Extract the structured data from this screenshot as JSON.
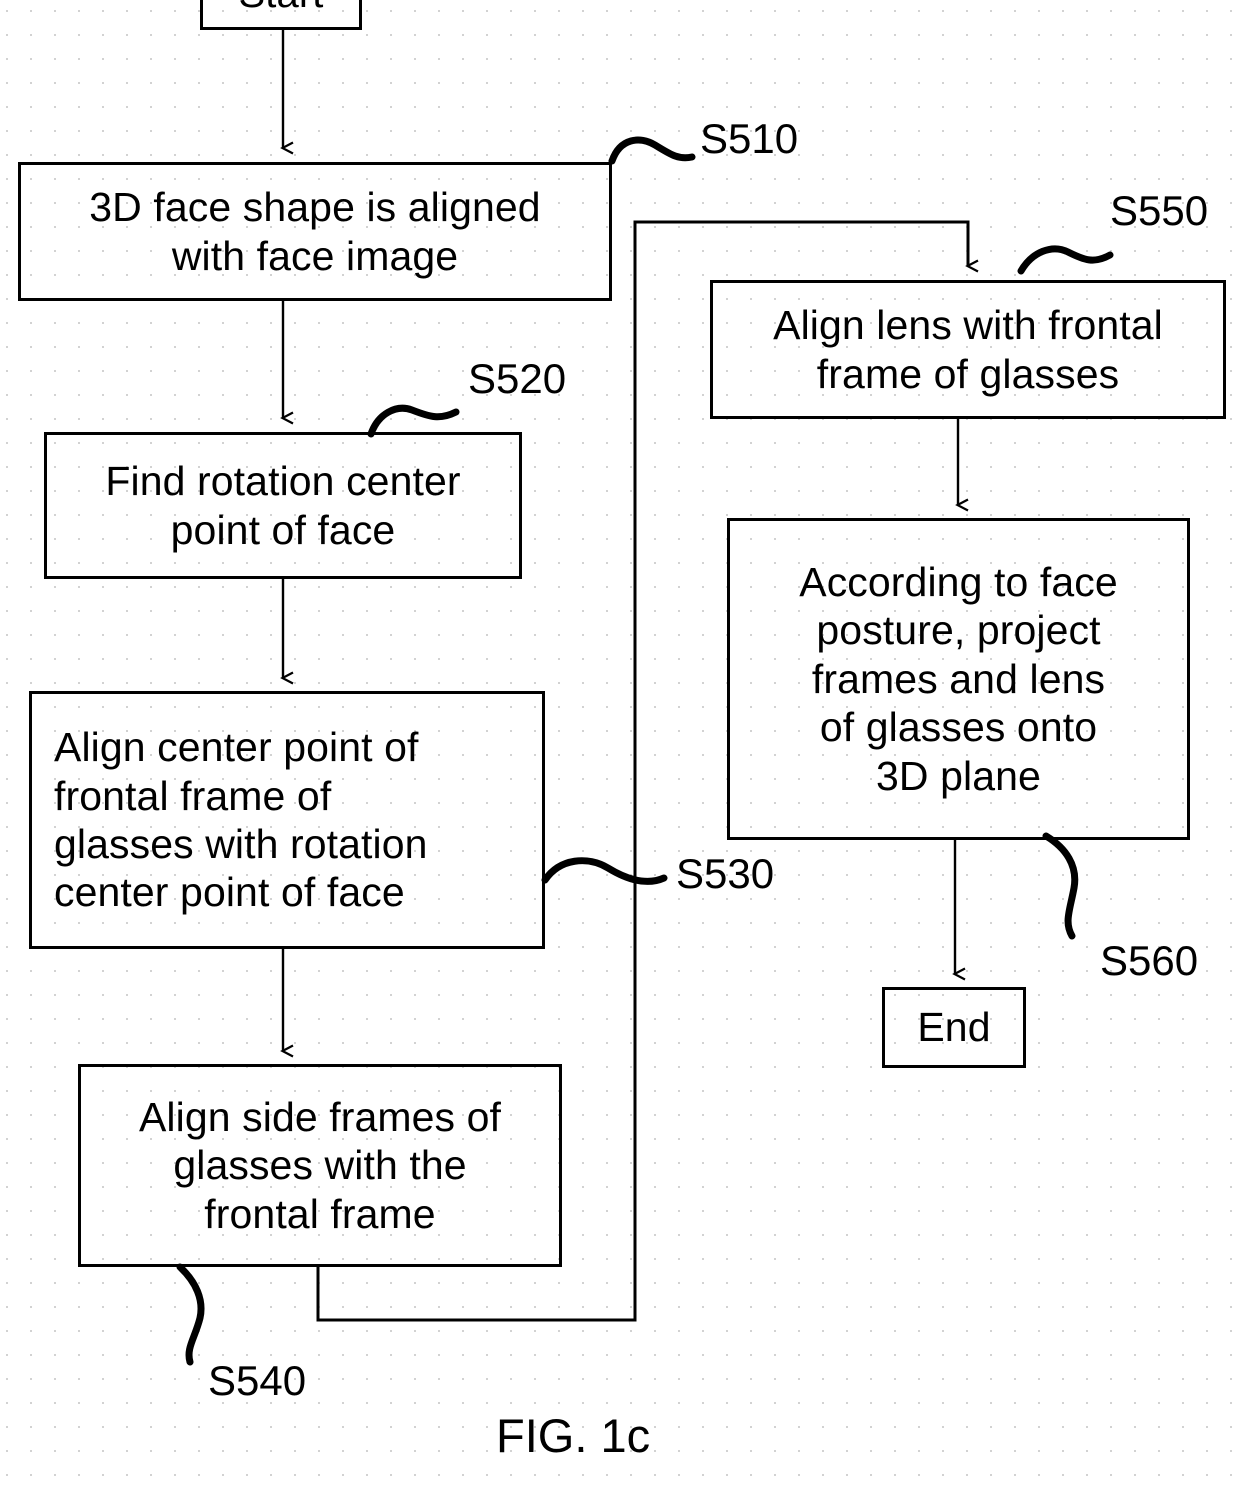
{
  "figure": {
    "caption": "FIG. 1c",
    "type": "flowchart",
    "colors": {
      "stroke": "#000000",
      "background": "#ffffff",
      "text": "#000000"
    }
  },
  "nodes": {
    "start": {
      "label": "Start",
      "shape": "rectangle"
    },
    "s510": {
      "label": "3D face shape is aligned\nwith face image",
      "shape": "rectangle",
      "ref": "S510"
    },
    "s520": {
      "label": "Find rotation center\npoint of face",
      "shape": "rectangle",
      "ref": "S520"
    },
    "s530": {
      "label": "Align center point of\nfrontal frame of\nglasses with rotation\ncenter point of face",
      "shape": "rectangle",
      "ref": "S530"
    },
    "s540": {
      "label": "Align side frames of\nglasses with the\nfrontal frame",
      "shape": "rectangle",
      "ref": "S540"
    },
    "s550": {
      "label": "Align lens with frontal\nframe of glasses",
      "shape": "rectangle",
      "ref": "S550"
    },
    "s560": {
      "label": "According to face\nposture, project\nframes and lens\nof glasses onto\n3D plane",
      "shape": "rectangle",
      "ref": "S560"
    },
    "end": {
      "label": "End",
      "shape": "rectangle"
    }
  },
  "step_labels": {
    "s510": "S510",
    "s520": "S520",
    "s530": "S530",
    "s540": "S540",
    "s550": "S550",
    "s560": "S560"
  },
  "edges": [
    {
      "from": "start",
      "to": "s510",
      "arrow": true
    },
    {
      "from": "s510",
      "to": "s520",
      "arrow": true
    },
    {
      "from": "s520",
      "to": "s530",
      "arrow": true
    },
    {
      "from": "s530",
      "to": "s540",
      "arrow": true
    },
    {
      "from": "s540",
      "to": "s550",
      "arrow": true,
      "routing": "down-right-up-right-down"
    },
    {
      "from": "s550",
      "to": "s560",
      "arrow": true
    },
    {
      "from": "s560",
      "to": "end",
      "arrow": true
    }
  ]
}
